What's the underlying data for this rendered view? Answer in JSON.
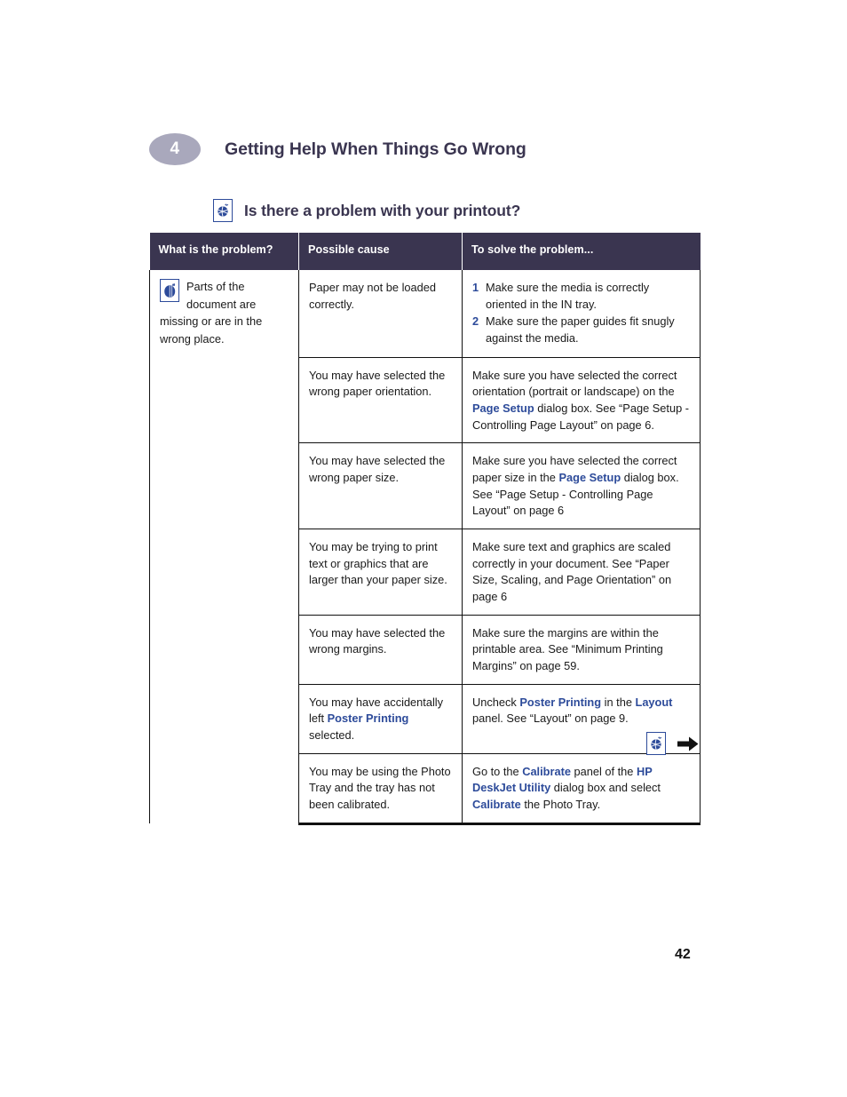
{
  "chapter": {
    "number": "4",
    "title": "Getting Help When Things Go Wrong"
  },
  "section": {
    "icon": "printer-globe-icon",
    "title": "Is there a problem with your printout?"
  },
  "table": {
    "headers": {
      "problem": "What is the problem?",
      "cause": "Possible cause",
      "solve": "To solve the problem..."
    },
    "problem": {
      "icon": "document-page-icon",
      "text": "Parts of the document are missing or are in the wrong place."
    },
    "rows": [
      {
        "cause_parts": [
          {
            "t": "Paper may not be loaded correctly.",
            "b": false
          }
        ],
        "solution_steps": [
          {
            "num": "1",
            "text": "Make sure the media is correctly oriented in the IN tray."
          },
          {
            "num": "2",
            "text": "Make sure the paper guides fit snugly against the media."
          }
        ]
      },
      {
        "cause_parts": [
          {
            "t": "You may have selected the wrong paper orientation.",
            "b": false
          }
        ],
        "solution_parts": [
          {
            "t": "Make sure you have selected the correct orientation (portrait or landscape) on the ",
            "b": false
          },
          {
            "t": "Page Setup",
            "b": true
          },
          {
            "t": " dialog box. See “Page Setup - Controlling Page Layout” on page 6.",
            "b": false
          }
        ]
      },
      {
        "cause_parts": [
          {
            "t": "You may have selected the wrong paper size.",
            "b": false
          }
        ],
        "solution_parts": [
          {
            "t": "Make sure you have selected the correct paper size in the ",
            "b": false
          },
          {
            "t": "Page Setup",
            "b": true
          },
          {
            "t": " dialog box. See “Page Setup - Controlling Page Layout” on page 6",
            "b": false
          }
        ]
      },
      {
        "cause_parts": [
          {
            "t": "You may be trying to print text or graphics that are larger than your paper size.",
            "b": false
          }
        ],
        "solution_parts": [
          {
            "t": "Make sure text and graphics are scaled correctly in your document. See “Paper Size, Scaling, and Page Orientation” on page 6",
            "b": false
          }
        ]
      },
      {
        "cause_parts": [
          {
            "t": "You may have selected the wrong margins.",
            "b": false
          }
        ],
        "solution_parts": [
          {
            "t": "Make sure the margins are within the printable area. See “Minimum Printing Margins” on page 59.",
            "b": false
          }
        ]
      },
      {
        "cause_parts": [
          {
            "t": "You may have accidentally left ",
            "b": false
          },
          {
            "t": "Poster Printing",
            "b": true
          },
          {
            "t": " selected.",
            "b": false
          }
        ],
        "solution_parts": [
          {
            "t": "Uncheck ",
            "b": false
          },
          {
            "t": "Poster Printing",
            "b": true
          },
          {
            "t": " in the ",
            "b": false
          },
          {
            "t": "Layout",
            "b": true
          },
          {
            "t": " panel. See “Layout” on page 9.",
            "b": false
          }
        ]
      },
      {
        "cause_parts": [
          {
            "t": "You may be using the Photo Tray and the tray has not been calibrated.",
            "b": false
          }
        ],
        "solution_parts": [
          {
            "t": "Go to the ",
            "b": false
          },
          {
            "t": "Calibrate",
            "b": true
          },
          {
            "t": " panel of the ",
            "b": false
          },
          {
            "t": "HP DeskJet Utility",
            "b": true
          },
          {
            "t": " dialog box and select ",
            "b": false
          },
          {
            "t": "Calibrate",
            "b": true
          },
          {
            "t": " the Photo Tray.",
            "b": false
          }
        ]
      }
    ]
  },
  "footer": {
    "home_icon": "printer-globe-icon",
    "next_icon": "right-arrow-icon",
    "page_number": "42"
  },
  "colors": {
    "header_bg": "#3a3550",
    "badge_bg": "#a9a8bc",
    "accent_blue": "#2d4b9a"
  }
}
